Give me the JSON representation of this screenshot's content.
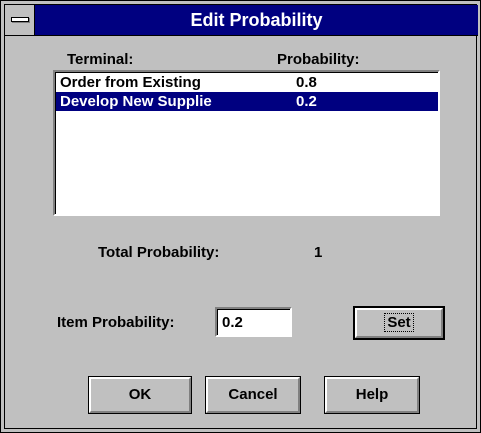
{
  "window": {
    "title": "Edit Probability"
  },
  "list": {
    "col_terminal": "Terminal:",
    "col_probability": "Probability:",
    "rows": [
      {
        "terminal": "Order from Existing",
        "probability": "0.8",
        "selected": false
      },
      {
        "terminal": "Develop New Supplie",
        "probability": "0.2",
        "selected": true
      }
    ]
  },
  "total": {
    "label": "Total Probability:",
    "value": "1"
  },
  "item": {
    "label": "Item Probability:",
    "value": "0.2"
  },
  "buttons": {
    "set": "Set",
    "ok": "OK",
    "cancel": "Cancel",
    "help": "Help"
  },
  "colors": {
    "titlebar": "#000080",
    "selection": "#000080",
    "face": "#c0c0c0"
  },
  "icons": {
    "system_menu": "system-menu-icon"
  }
}
